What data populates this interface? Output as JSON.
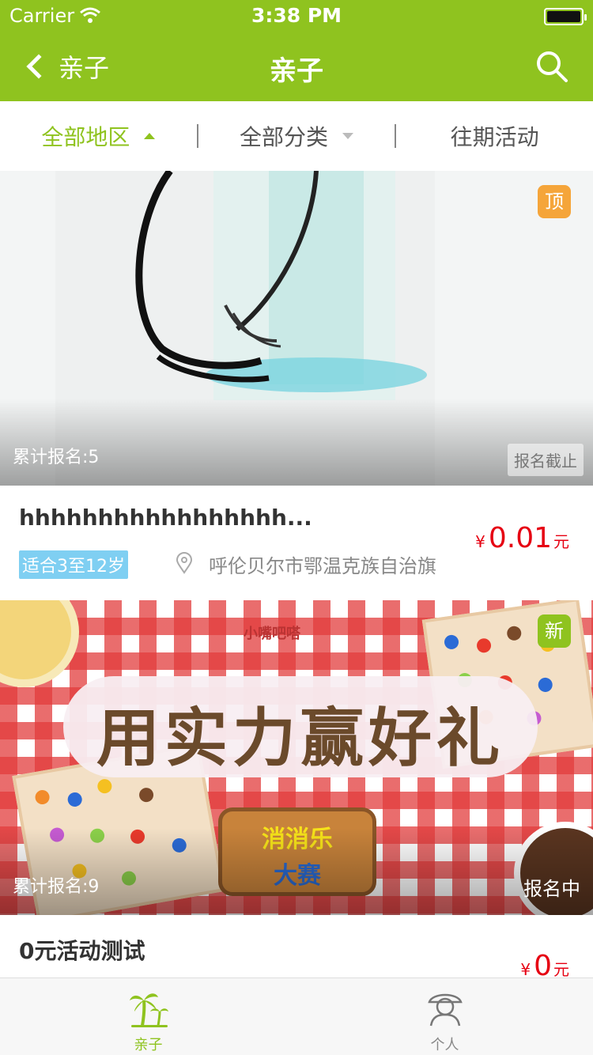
{
  "status_bar": {
    "carrier": "Carrier",
    "time": "3:38 PM"
  },
  "nav": {
    "back_label": "亲子",
    "title": "亲子"
  },
  "filters": [
    {
      "label": "全部地区",
      "arrow": "up",
      "active": true
    },
    {
      "label": "全部分类",
      "arrow": "down",
      "active": false
    },
    {
      "label": "往期活动",
      "arrow": "none",
      "active": false
    }
  ],
  "cards": [
    {
      "badge": "顶",
      "signup_count": "累计报名:5",
      "status": "报名截止",
      "title": "hhhhhhhhhhhhhhhhh...",
      "age_tag": "适合3至12岁",
      "location": "呼伦贝尔市鄂温克族自治旗",
      "price": {
        "currency": "¥",
        "amount": "0.01",
        "unit": "元"
      }
    },
    {
      "badge": "新",
      "signup_count": "累计报名:9",
      "status": "报名中",
      "title": "0元活动测试",
      "price": {
        "currency": "¥",
        "amount": "0",
        "unit": "元"
      },
      "image_text": {
        "brand": "小嘴吧嗒",
        "headline": "用实力赢好礼",
        "game_line1": "消消乐",
        "game_line2": "大赛"
      }
    }
  ],
  "tabs": [
    {
      "label": "亲子",
      "icon": "palm-tree-icon",
      "active": true
    },
    {
      "label": "个人",
      "icon": "person-icon",
      "active": false
    }
  ],
  "colors": {
    "brand_green": "#8fc31f",
    "price_red": "#e60012",
    "badge_orange": "#f5a53a",
    "age_tag_blue": "#7fcff2"
  }
}
